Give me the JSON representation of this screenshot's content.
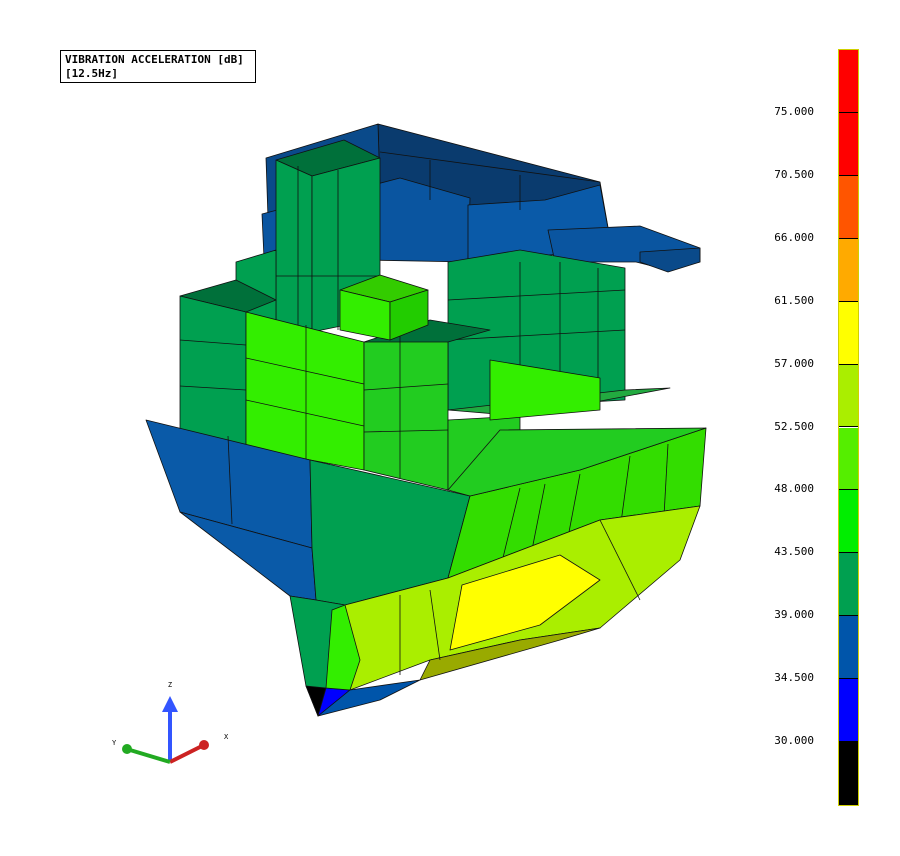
{
  "plot": {
    "title_line1": "VIBRATION ACCELERATION [dB]",
    "title_line2": "[12.5Hz]"
  },
  "legend": {
    "ticks": [
      "75.000",
      "70.500",
      "66.000",
      "61.500",
      "57.000",
      "52.500",
      "48.000",
      "43.500",
      "39.000",
      "34.500",
      "30.000"
    ],
    "colors": [
      "#ff0000",
      "#ff0000",
      "#ff5500",
      "#ffaa00",
      "#ffff00",
      "#aaee00",
      "#55ee00",
      "#00ee00",
      "#00a050",
      "#0055aa",
      "#0000ff",
      "#000000"
    ]
  },
  "axes": {
    "x_label": "X",
    "y_label": "Y",
    "z_label": "Z"
  },
  "colors": {
    "dark_blue": "#0a3b6e",
    "blue": "#0a5aa8",
    "green": "#00a050",
    "light_green": "#33ee00",
    "yellow_green": "#aaee00",
    "yellow": "#ffff00"
  }
}
